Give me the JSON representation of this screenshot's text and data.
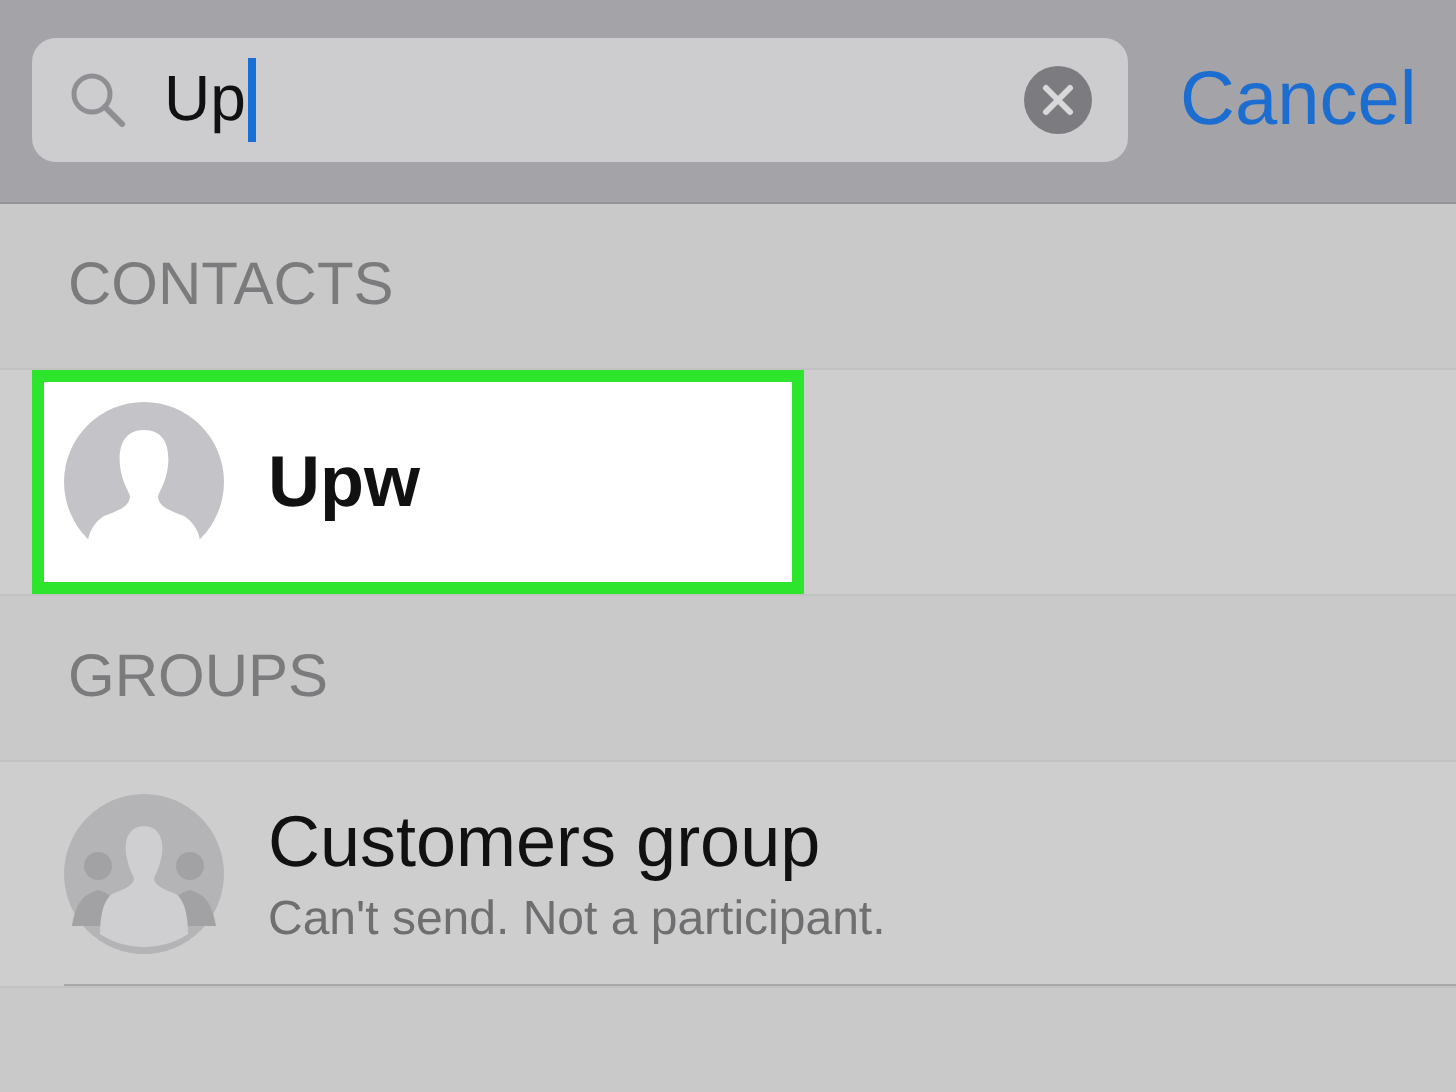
{
  "search": {
    "value": "Up",
    "cancel": "Cancel"
  },
  "sections": [
    {
      "title": "CONTACTS",
      "items": [
        {
          "kind": "contact",
          "name": "Upw",
          "highlighted": true
        }
      ]
    },
    {
      "title": "GROUPS",
      "items": [
        {
          "kind": "group",
          "name": "Customers group",
          "subtitle": "Can't send. Not a participant.",
          "highlighted": false
        }
      ]
    }
  ]
}
